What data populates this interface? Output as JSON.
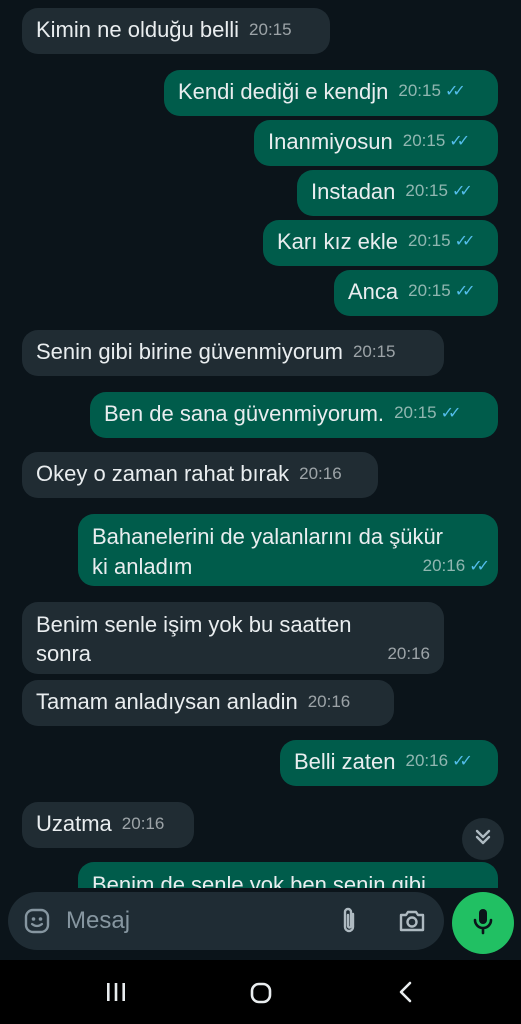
{
  "messages": [
    {
      "dir": "in",
      "text": "Kimin ne olduğu belli",
      "time": "20:15"
    },
    {
      "dir": "out",
      "text": "Kendi dediği e kendjn",
      "time": "20:15"
    },
    {
      "dir": "out",
      "text": "Inanmiyosun",
      "time": "20:15"
    },
    {
      "dir": "out",
      "text": "Instadan",
      "time": "20:15"
    },
    {
      "dir": "out",
      "text": "Karı kız ekle",
      "time": "20:15"
    },
    {
      "dir": "out",
      "text": "Anca",
      "time": "20:15"
    },
    {
      "dir": "in",
      "text": "Senin gibi birine güvenmiyorum",
      "time": "20:15"
    },
    {
      "dir": "out",
      "text": "Ben de sana güvenmiyorum.",
      "time": "20:15"
    },
    {
      "dir": "in",
      "text": "Okey o zaman rahat bırak",
      "time": "20:16"
    },
    {
      "dir": "out",
      "line1": "Bahanelerini de yalanlarını da şükür",
      "line2": "ki anladım",
      "time": "20:16"
    },
    {
      "dir": "in",
      "line1": "Benim senle işim yok bu saatten",
      "line2": "sonra",
      "time": "20:16"
    },
    {
      "dir": "in",
      "text": "Tamam anladıysan anladin",
      "time": "20:16"
    },
    {
      "dir": "out",
      "text": "Belli zaten",
      "time": "20:16"
    },
    {
      "dir": "in",
      "text": "Uzatma",
      "time": "20:16"
    },
    {
      "dir": "out",
      "text": "Benim de senle yok ben senin gibi"
    }
  ],
  "composer": {
    "placeholder": "Mesaj"
  },
  "icons": {
    "emoji": "sticker-icon",
    "attach": "paperclip-icon",
    "camera": "camera-icon",
    "mic": "microphone-icon",
    "scroll": "double-chevron-down-icon",
    "nav_recent": "recent-apps-icon",
    "nav_home": "home-icon",
    "nav_back": "back-icon"
  },
  "colors": {
    "incoming": "#202c33",
    "outgoing": "#005c4b",
    "read_ticks": "#53bdeb",
    "mic_button": "#21c063"
  }
}
